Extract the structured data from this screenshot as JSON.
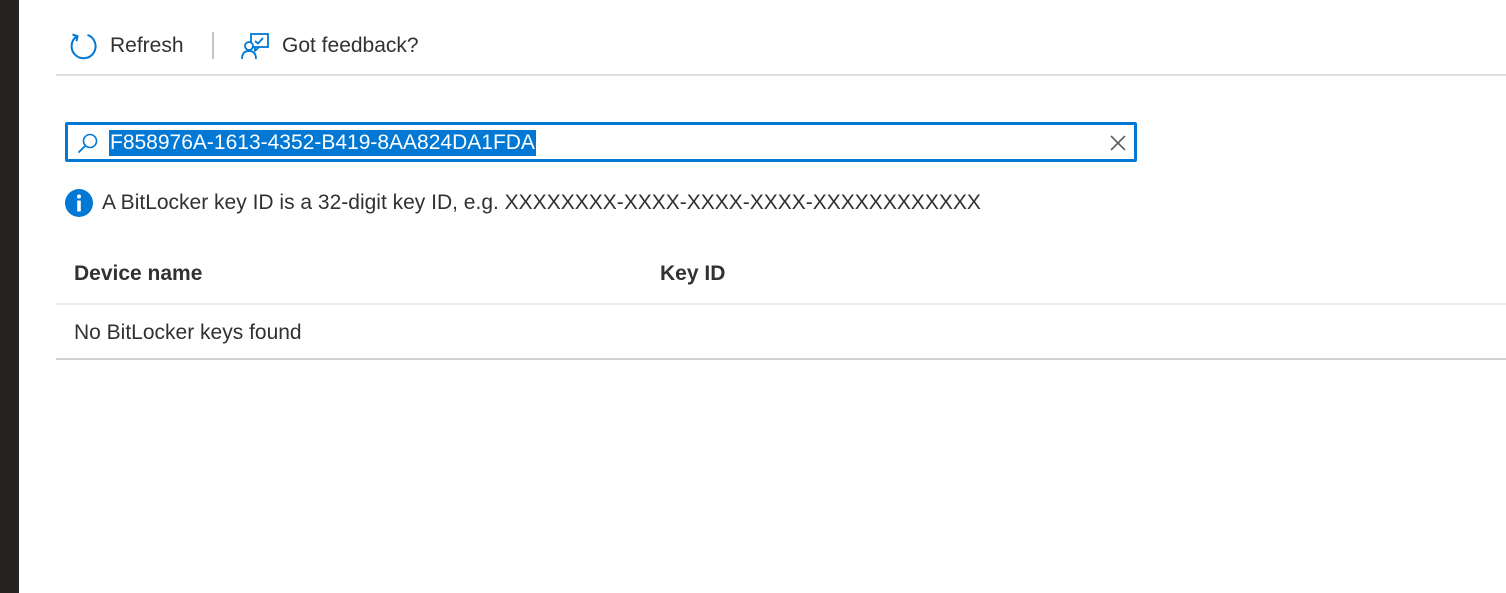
{
  "toolbar": {
    "refresh_label": "Refresh",
    "refresh_icon": "refresh-icon",
    "feedback_label": "Got feedback?",
    "feedback_icon": "feedback-icon"
  },
  "search": {
    "value": "F858976A-1613-4352-B419-8AA824DA1FDA",
    "search_icon": "search-icon",
    "clear_icon": "close-icon"
  },
  "info": {
    "icon": "info-icon",
    "text": "A BitLocker key ID is a 32-digit key ID, e.g. XXXXXXXX-XXXX-XXXX-XXXX-XXXXXXXXXXXX"
  },
  "table": {
    "columns": [
      "Device name",
      "Key ID"
    ],
    "empty_message": "No BitLocker keys found"
  },
  "colors": {
    "accent": "#0078d4",
    "text": "#323130",
    "rail": "#252423",
    "divider": "#e1dfdd"
  }
}
